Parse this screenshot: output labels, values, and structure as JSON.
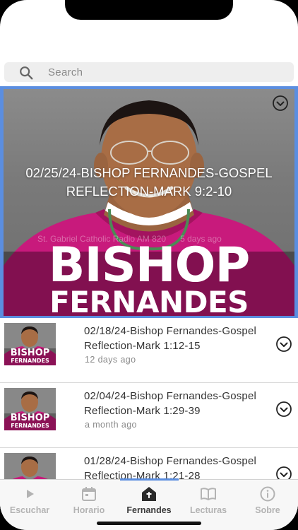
{
  "search": {
    "placeholder": "Search"
  },
  "featured": {
    "title": "02/25/24-BISHOP FERNANDES-GOSPEL REFLECTION-MARK 9:2-10",
    "station": "St. Gabriel Catholic Radio AM 820",
    "time": "5 days ago",
    "logo_line1": "BISHOP",
    "logo_line2": "FERNANDES",
    "download_icon": "download-circle-icon"
  },
  "episodes": [
    {
      "title": "02/18/24-Bishop Fernandes-Gospel Reflection-Mark 1:12-15",
      "time": "12 days ago",
      "thumb_line1": "BISHOP",
      "thumb_line2": "FERNANDES"
    },
    {
      "title": "02/04/24-Bishop Fernandes-Gospel Reflection-Mark 1:29-39",
      "time": "a month ago",
      "thumb_line1": "BISHOP",
      "thumb_line2": "FERNANDES"
    },
    {
      "title": "01/28/24-Bishop Fernandes-Gospel Reflection-Mark 1:21-28",
      "time": "",
      "thumb_line1": "",
      "thumb_line2": ""
    }
  ],
  "tabs": [
    {
      "label": "Escuchar",
      "icon": "play-icon",
      "active": false
    },
    {
      "label": "Horario",
      "icon": "calendar-icon",
      "active": false
    },
    {
      "label": "Fernandes",
      "icon": "church-icon",
      "active": true
    },
    {
      "label": "Lecturas",
      "icon": "book-icon",
      "active": false
    },
    {
      "label": "Sobre",
      "icon": "info-icon",
      "active": false
    }
  ],
  "colors": {
    "accent": "#5b8ee0",
    "vestment": "#c81a7c",
    "text": "#333333",
    "muted": "#8a8a8a"
  }
}
